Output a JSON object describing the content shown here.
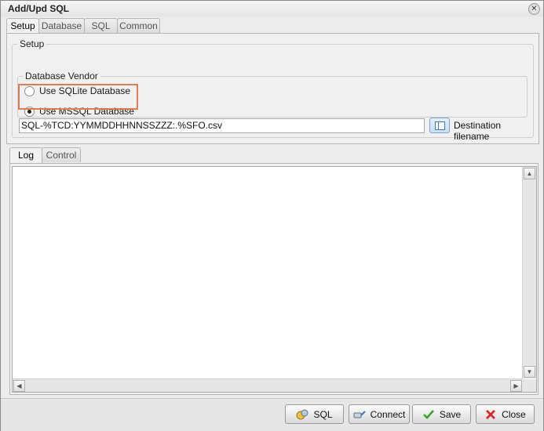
{
  "window": {
    "title": "Add/Upd SQL"
  },
  "tabs": [
    {
      "label": "Setup",
      "active": true
    },
    {
      "label": "Database",
      "active": false
    },
    {
      "label": "SQL",
      "active": false
    },
    {
      "label": "Common",
      "active": false
    }
  ],
  "setup": {
    "legend": "Setup",
    "vendor": {
      "legend": "Database Vendor",
      "options": [
        {
          "label": "Use SQLite Database",
          "checked": false
        },
        {
          "label": "Use MSSQL Database",
          "checked": true
        }
      ]
    },
    "filename_value": "SQL-%TCD:YYMMDDHHNNSSZZZ:.%SFO.csv",
    "destination_label": "Destination filename"
  },
  "log_tabs": [
    {
      "label": "Log",
      "active": true
    },
    {
      "label": "Control",
      "active": false
    }
  ],
  "log": {
    "content": ""
  },
  "footer": {
    "buttons": [
      {
        "label": "SQL",
        "icon": "sql-icon"
      },
      {
        "label": "Connect",
        "icon": "connect-icon"
      },
      {
        "label": "Save",
        "icon": "checkmark-icon"
      },
      {
        "label": "Close",
        "icon": "red-x-icon"
      }
    ]
  },
  "colors": {
    "highlight": "#e07b55",
    "save_check": "#3aa12a",
    "close_x": "#d42a2a"
  }
}
